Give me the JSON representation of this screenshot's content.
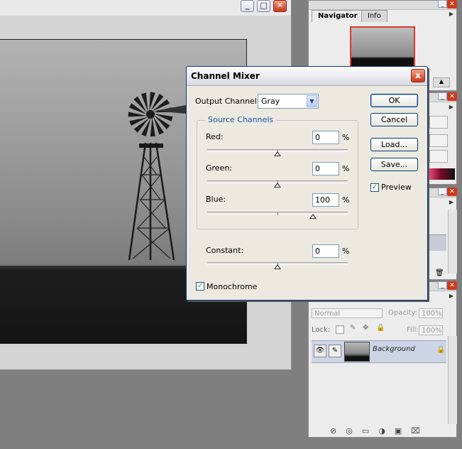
{
  "dialog": {
    "title": "Channel Mixer",
    "close_label": "x",
    "output_channel_label": "Output Channel:",
    "output_channel_value": "Gray",
    "source_channels_label": "Source Channels",
    "red_label": "Red:",
    "red_value": "0",
    "green_label": "Green:",
    "green_value": "0",
    "blue_label": "Blue:",
    "blue_value": "100",
    "constant_label": "Constant:",
    "constant_value": "0",
    "percent": "%",
    "monochrome_label": "Monochrome",
    "monochrome_checked": true,
    "preview_label": "Preview",
    "preview_checked": true,
    "buttons": {
      "ok": "OK",
      "cancel": "Cancel",
      "load": "Load...",
      "save": "Save..."
    }
  },
  "navigator": {
    "tab_navigator": "Navigator",
    "tab_info": "Info"
  },
  "layers": {
    "blend_mode": "Normal",
    "opacity_label": "Opacity:",
    "opacity_value": "100%",
    "lock_label": "Lock:",
    "fill_label": "Fill:",
    "fill_value": "100%",
    "layer_name": "Background"
  },
  "colors": {
    "accent": "#1f4fa8",
    "close_red": "#cc3b1b",
    "selected_layer": "#cdd4e5"
  }
}
